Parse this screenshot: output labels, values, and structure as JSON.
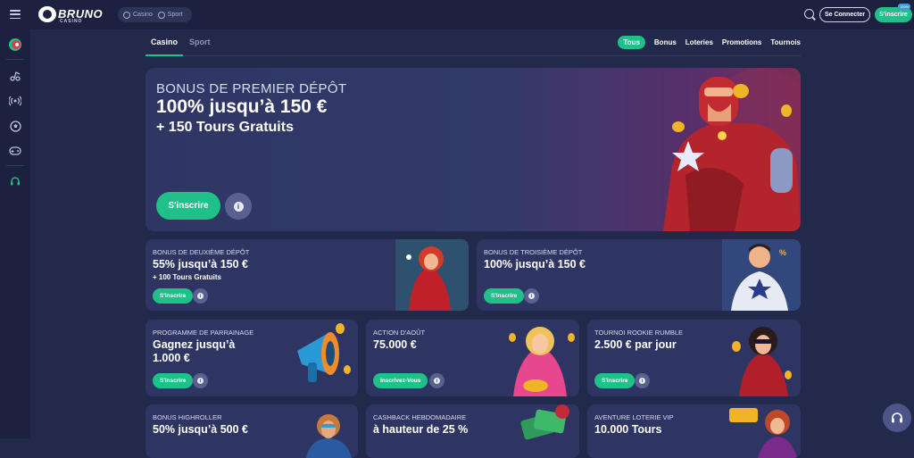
{
  "header": {
    "logo_text": "BRUNO",
    "logo_sub": "CASINO",
    "segments": [
      "Casino",
      "Sport"
    ],
    "login_label": "Se Connecter",
    "signup_label": "S'inscrire",
    "signup_badge": "100%"
  },
  "tabs": {
    "casino": "Casino",
    "sport": "Sport"
  },
  "filters": [
    "Tous",
    "Bonus",
    "Loteries",
    "Promotions",
    "Tournois"
  ],
  "hero": {
    "subtitle": "BONUS DE PREMIER DÉPÔT",
    "title": "100% jusqu’à 150 €",
    "extra": "+ 150 Tours Gratuits",
    "cta": "S'inscrire",
    "info": "i"
  },
  "cards": [
    {
      "subtitle": "BONUS DE DEUXIÈME DÉPÔT",
      "title": "55% jusqu’à 150 €",
      "extra": "+ 100 Tours Gratuits",
      "cta": "S'inscrire"
    },
    {
      "subtitle": "BONUS DE TROISIÈME DÉPÔT",
      "title": "100% jusqu’à 150 €",
      "extra": "",
      "cta": "S'inscrire"
    },
    {
      "subtitle": "PROGRAMME DE PARRAINAGE",
      "title": "Gagnez jusqu’à 1.000 €",
      "extra": "",
      "cta": "S'inscrire"
    },
    {
      "subtitle": "ACTION D'AOÛT",
      "title": "75.000 €",
      "extra": "",
      "cta": "Inscrivez-Vous"
    },
    {
      "subtitle": "TOURNOI ROOKIE RUMBLE",
      "title": "2.500 € par jour",
      "extra": "",
      "cta": "S'inscrire"
    },
    {
      "subtitle": "BONUS HIGHROLLER",
      "title": "50% jusqu’à 500 €",
      "extra": "",
      "cta": ""
    },
    {
      "subtitle": "CASHBACK HEBDOMADAIRE",
      "title": "à hauteur de 25 %",
      "extra": "",
      "cta": ""
    },
    {
      "subtitle": "AVENTURE LOTERIE VIP",
      "title": "10.000 Tours",
      "extra": "",
      "cta": ""
    }
  ],
  "colors": {
    "background": "#23294a",
    "panel": "#1c2140",
    "card": "#2f3562",
    "accent": "#1fc08a"
  },
  "icons": {
    "sidebar": [
      "promo-icon",
      "music-icon",
      "live-icon",
      "soccer-icon",
      "gamepad-icon",
      "support-icon"
    ],
    "header": [
      "menu-icon",
      "search-icon"
    ],
    "floating": "headset-icon"
  }
}
